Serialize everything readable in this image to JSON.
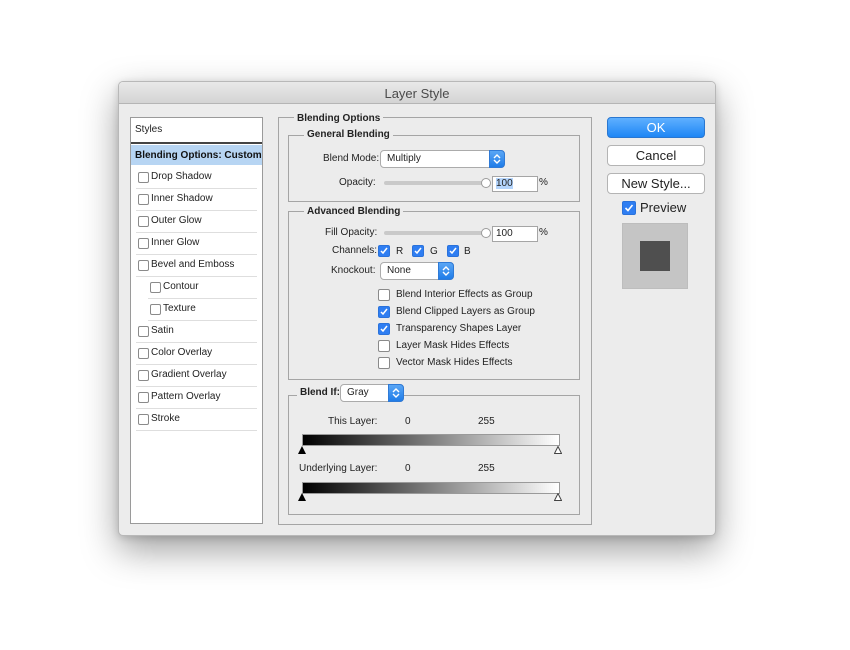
{
  "window": {
    "title": "Layer Style"
  },
  "styles_panel": {
    "header": "Styles",
    "selected": "Blending Options: Custom",
    "items": [
      {
        "label": "Drop Shadow"
      },
      {
        "label": "Inner Shadow"
      },
      {
        "label": "Outer Glow"
      },
      {
        "label": "Inner Glow"
      },
      {
        "label": "Bevel and Emboss"
      },
      {
        "label": "Contour"
      },
      {
        "label": "Texture"
      },
      {
        "label": "Satin"
      },
      {
        "label": "Color Overlay"
      },
      {
        "label": "Gradient Overlay"
      },
      {
        "label": "Pattern Overlay"
      },
      {
        "label": "Stroke"
      }
    ]
  },
  "blending_options": {
    "title": "Blending Options",
    "general": {
      "title": "General Blending",
      "blend_mode_label": "Blend Mode:",
      "blend_mode_value": "Multiply",
      "opacity_label": "Opacity:",
      "opacity_value": "100",
      "percent": "%"
    },
    "advanced": {
      "title": "Advanced Blending",
      "fill_opacity_label": "Fill Opacity:",
      "fill_opacity_value": "100",
      "percent": "%",
      "channels_label": "Channels:",
      "channel_r": "R",
      "channel_g": "G",
      "channel_b": "B",
      "knockout_label": "Knockout:",
      "knockout_value": "None",
      "options": [
        {
          "label": "Blend Interior Effects as Group",
          "checked": false
        },
        {
          "label": "Blend Clipped Layers as Group",
          "checked": true
        },
        {
          "label": "Transparency Shapes Layer",
          "checked": true
        },
        {
          "label": "Layer Mask Hides Effects",
          "checked": false
        },
        {
          "label": "Vector Mask Hides Effects",
          "checked": false
        }
      ]
    },
    "blend_if": {
      "label": "Blend If:",
      "value": "Gray",
      "this_layer_label": "This Layer:",
      "this_layer_min": "0",
      "this_layer_max": "255",
      "underlying_label": "Underlying Layer:",
      "underlying_min": "0",
      "underlying_max": "255"
    }
  },
  "buttons": {
    "ok": "OK",
    "cancel": "Cancel",
    "new_style": "New Style..."
  },
  "preview": {
    "label": "Preview",
    "checked": true
  },
  "colors": {
    "accent": "#1e86f5",
    "selection": "#b7d5f3",
    "preview_swatch": "#4f4f4f"
  }
}
